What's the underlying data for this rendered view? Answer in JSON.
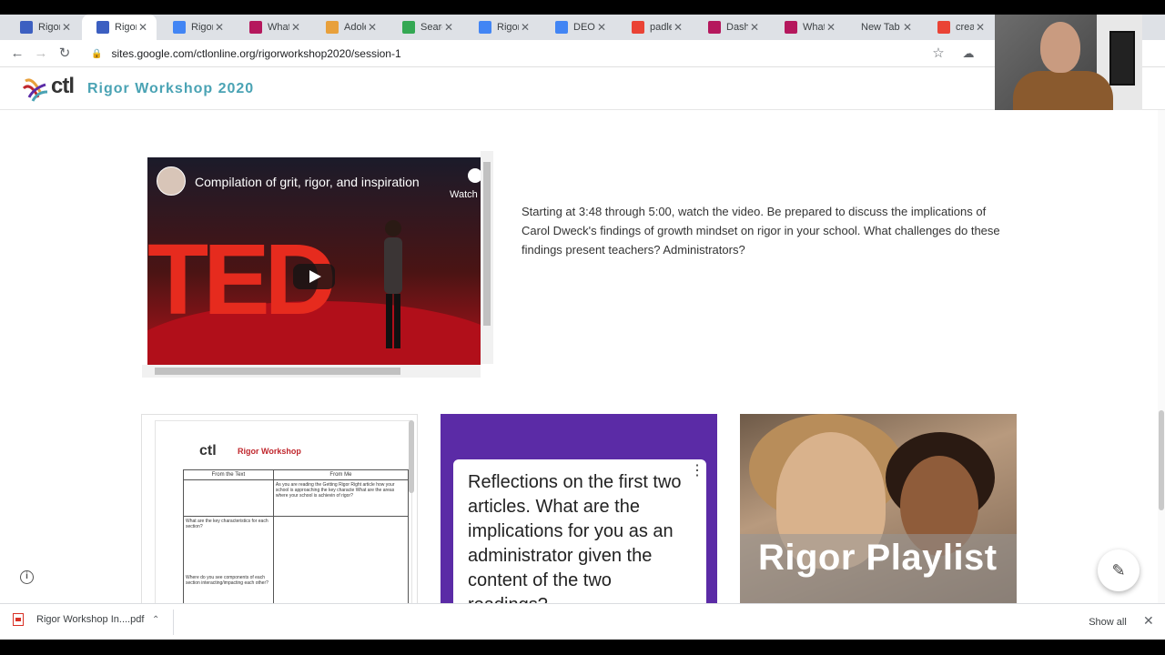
{
  "browser": {
    "tabs": [
      {
        "label": "Rigor V",
        "color": "#3c5fc1"
      },
      {
        "label": "Rigor V",
        "color": "#3c5fc1",
        "active": true
      },
      {
        "label": "Rigor I",
        "color": "#4285f4"
      },
      {
        "label": "What c",
        "color": "#b5185d"
      },
      {
        "label": "Adoles",
        "color": "#e8a03b"
      },
      {
        "label": "Search",
        "color": "#34a853"
      },
      {
        "label": "Rigor I",
        "color": "#4285f4"
      },
      {
        "label": "DEO Te",
        "color": "#4285f4"
      },
      {
        "label": "padlet",
        "color": "#ea4335"
      },
      {
        "label": "Dashb",
        "color": "#b5185d"
      },
      {
        "label": "What c",
        "color": "#b5185d"
      },
      {
        "label": "New Tab",
        "color": ""
      },
      {
        "label": "creatin",
        "color": "#ea4335"
      }
    ],
    "url": "sites.google.com/ctlonline.org/rigorworkshop2020/session-1"
  },
  "site": {
    "logo_text": "ctl",
    "title": "Rigor Workshop 2020"
  },
  "video": {
    "title": "Compilation of grit, rigor, and inspiration",
    "watch_label": "Watch",
    "ted_text": "TED"
  },
  "description": "Starting at 3:48 through 5:00, watch the video. Be prepared to discuss the implications of Carol Dweck's findings of growth mindset on rigor in your school. What challenges do these findings present teachers? Administrators?",
  "cards": {
    "doc": {
      "logo": "ctl",
      "title": "Rigor Workshop",
      "col1": "From the Text",
      "col2": "From Me",
      "row1_right": "As you are reading the Getting Rigor Right article how your school is approaching the key characte What are the areas where your school is achievin of rigor?",
      "row2_left": "What are the key characteristics for each section?",
      "row3_left": "Where do you see components of each section interacting/impacting each other?"
    },
    "reflection": "Reflections on the first two articles. What are the implications for you as an administrator given the content of the two readings?",
    "playlist": "Rigor Playlist"
  },
  "downloads": {
    "file": "Rigor Workshop In....pdf",
    "show_all": "Show all"
  }
}
